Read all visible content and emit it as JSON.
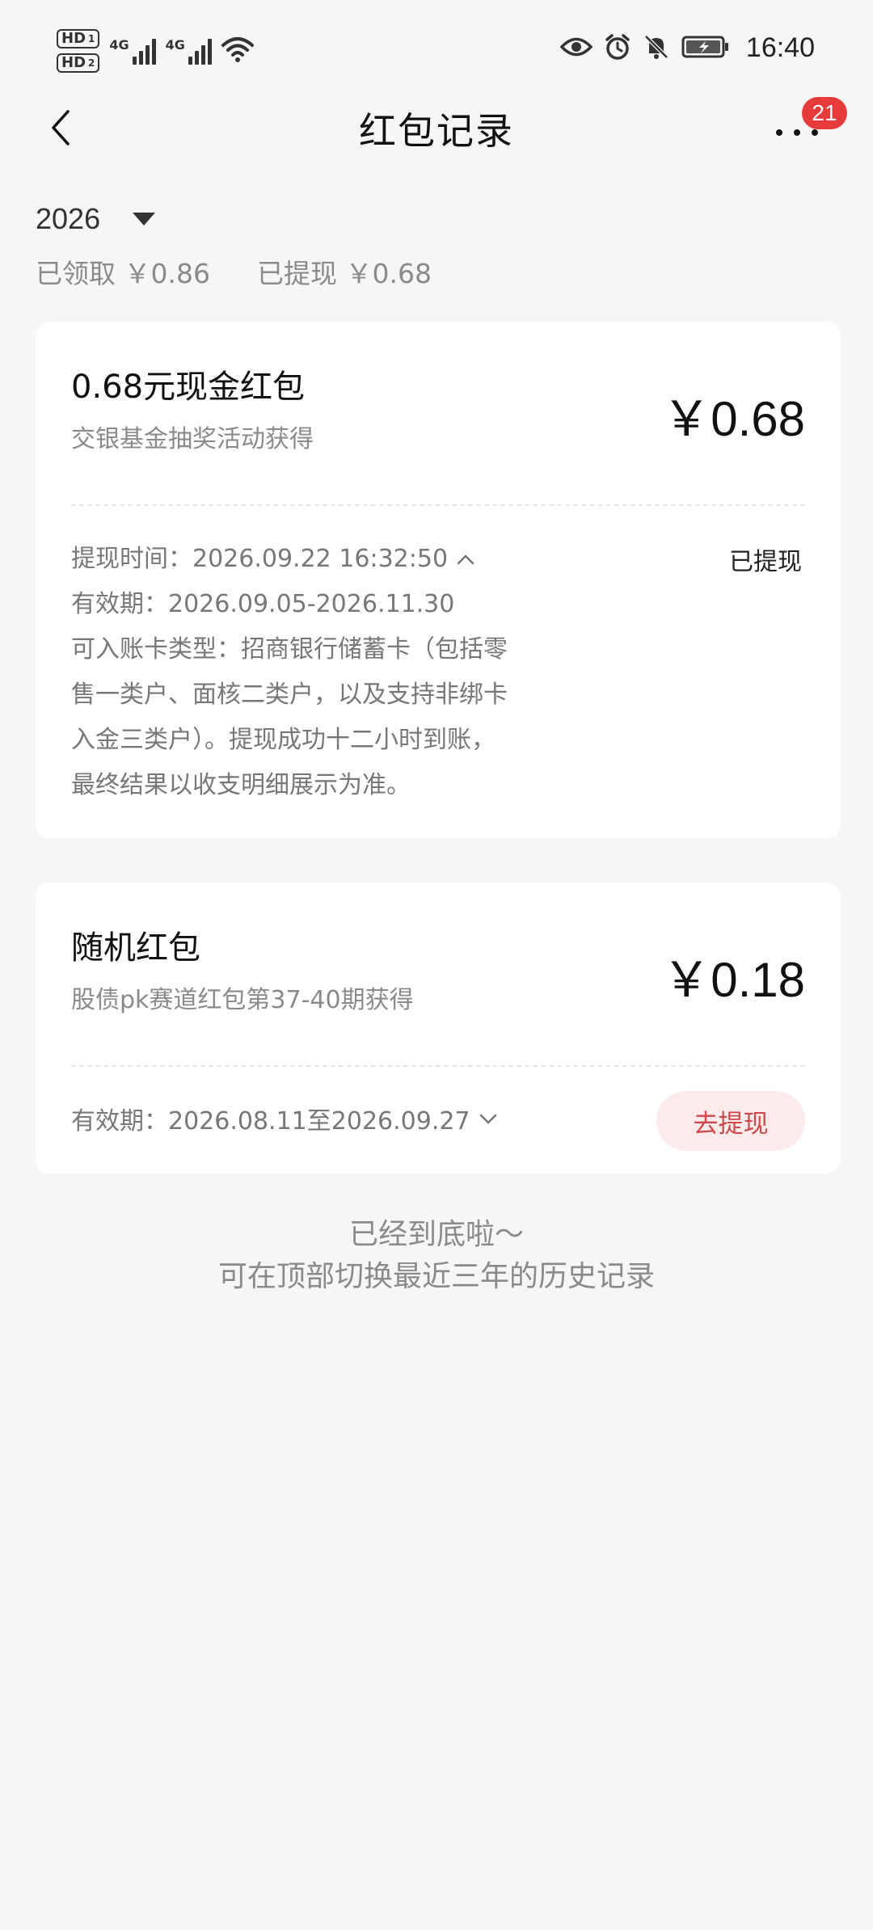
{
  "status_bar": {
    "hd1_label": "HD",
    "hd1_index": "1",
    "hd2_label": "HD",
    "hd2_index": "2",
    "net1_label": "4G",
    "net2_label": "4G",
    "time": "16:40",
    "icons": [
      "eye-icon",
      "alarm-icon",
      "bell-off-icon",
      "battery-charging-icon",
      "wifi-icon",
      "signal-icon"
    ]
  },
  "nav": {
    "title": "红包记录",
    "badge_count": "21",
    "icons": [
      "back-chevron-icon",
      "more-dots-icon"
    ]
  },
  "filter": {
    "year": "2026",
    "received": "已领取 ￥0.86",
    "withdrawn": "已提现 ￥0.68"
  },
  "records": [
    {
      "title": "0.68元现金红包",
      "source": "交银基金抽奖活动获得",
      "amount": "￥0.68",
      "withdraw_time": "提现时间：2026.09.22 16:32:50",
      "validity": "有效期：2026.09.05-2026.11.30",
      "account_type_lines": [
        "可入账卡类型：招商银行储蓄卡（包括零",
        "售一类户、面核二类户，以及支持非绑卡",
        "入金三类户）。提现成功十二小时到账，",
        "最终结果以收支明细展示为准。"
      ],
      "status": "已提现"
    },
    {
      "title": "随机红包",
      "source": "股债pk赛道红包第37-40期获得",
      "amount": "￥0.18",
      "validity": "有效期：2026.08.11至2026.09.27",
      "action_label": "去提现"
    }
  ],
  "footer": {
    "line1": "已经到底啦～",
    "line2": "可在顶部切换最近三年的历史记录"
  },
  "colors": {
    "background": "#f6f6f6",
    "card": "#ffffff",
    "badge": "#e73a3a",
    "action_bg": "#fdeaea",
    "action_text": "#d0484b"
  }
}
